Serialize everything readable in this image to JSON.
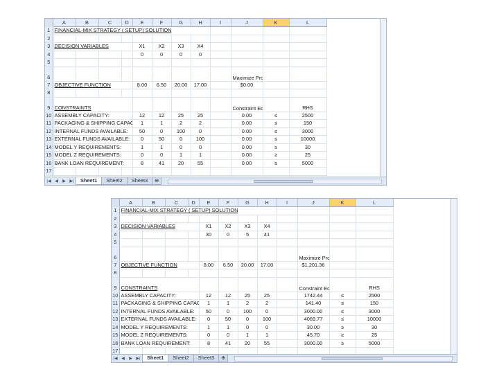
{
  "column_headers": [
    "A",
    "B",
    "C",
    "D",
    "E",
    "F",
    "G",
    "H",
    "I",
    "J",
    "K",
    "L"
  ],
  "selected_column": "K",
  "sheet_tabs": [
    "Sheet1",
    "Sheet2",
    "Sheet3"
  ],
  "active_tab": "Sheet1",
  "labels": {
    "r1": "FINANCIAL-MIX STRATEGY ( SETUP) SOLUTION",
    "r3": "DECISION VARIABLES",
    "r7": "OBJECTIVE FUNCTION",
    "r9": "CONSTRAINTS",
    "r10": "ASSEMBLY CAPACITY:",
    "r11": "PACKAGING & SHIPPING CAPACITY:",
    "r12": "INTERNAL FUNDS AVAILABLE:",
    "r13": "EXTERNAL FUNDS AVAILABLE:",
    "r14": "MODEL Y REQUIREMENTS:",
    "r15": "MODEL Z REQUIREMENTS:",
    "r16": "BANK LOAN REQUIREMENT:"
  },
  "vars": [
    "X1",
    "X2",
    "X3",
    "X4"
  ],
  "headers": {
    "maximize_profit": "Maximize Profit",
    "constraint_equations": "Constraint Equations",
    "rhs": "RHS"
  },
  "objective_coeffs": [
    "8.00",
    "6.50",
    "20.00",
    "17.00"
  ],
  "constraint_coeffs": [
    [
      "12",
      "12",
      "25",
      "25"
    ],
    [
      "1",
      "1",
      "2",
      "2"
    ],
    [
      "50",
      "0",
      "100",
      "0"
    ],
    [
      "0",
      "50",
      "0",
      "100"
    ],
    [
      "1",
      "1",
      "0",
      "0"
    ],
    [
      "0",
      "0",
      "1",
      "1"
    ],
    [
      "8",
      "41",
      "20",
      "55"
    ]
  ],
  "rhs": [
    "2500",
    "150",
    "3000",
    "10000",
    "30",
    "25",
    "5000"
  ],
  "signs": [
    "≤",
    "≤",
    "≤",
    "≤",
    "≥",
    "≥",
    "≥"
  ],
  "setup": {
    "var_values": [
      "0",
      "0",
      "0",
      "0"
    ],
    "profit": "$0.00",
    "constraint_values": [
      "0.00",
      "0.00",
      "0.00",
      "0.00",
      "0.00",
      "0.00",
      "0.00"
    ]
  },
  "solution": {
    "var_values": [
      "30",
      "0",
      "5",
      "41"
    ],
    "profit": "$1,201.36",
    "constraint_values": [
      "1742.44",
      "141.40",
      "3000.00",
      "4069.77",
      "30.00",
      "45.70",
      "3000.00"
    ]
  }
}
